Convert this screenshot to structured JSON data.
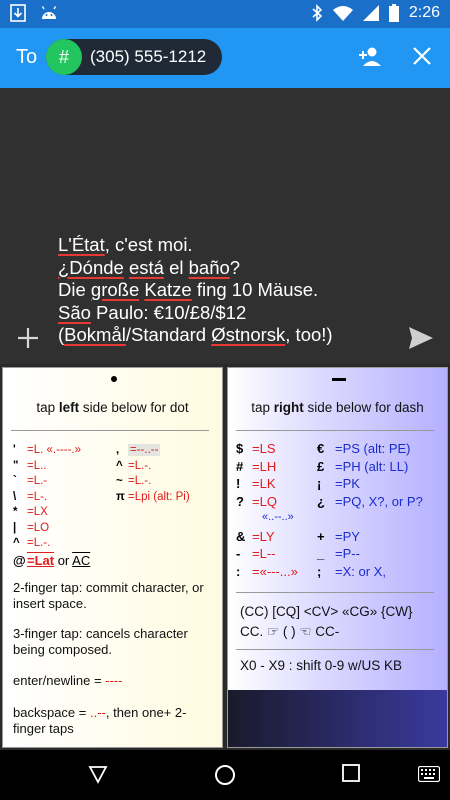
{
  "status": {
    "time": "2:26",
    "icons": [
      "download-icon",
      "android-icon",
      "bluetooth-icon",
      "wifi-icon",
      "signal-icon",
      "battery-icon"
    ]
  },
  "appbar": {
    "to_label": "To",
    "recipient_avatar": "#",
    "recipient": "(305) 555-1212",
    "icons": [
      "add-contact-icon",
      "close-icon"
    ]
  },
  "message": {
    "lines": [
      "L'État, c'est moi.",
      "¿Dónde está el baño?",
      "Die große Katze fing 10 Mäuse.",
      "São Paulo: €10/£8/$12",
      "(Bokmål/Standard Østnorsk, too!)"
    ]
  },
  "keyboard": {
    "left": {
      "symbol": "dot",
      "hint_pre": "tap ",
      "hint_bold": "left",
      "hint_post": " side below for dot",
      "col1": [
        {
          "k": "'",
          "v": "=L. «.----.»"
        },
        {
          "k": "\"",
          "v": "=L.."
        },
        {
          "k": "`",
          "v": "=L.-"
        },
        {
          "k": "\\",
          "v": "=L-."
        },
        {
          "k": "*",
          "v": "=LX"
        },
        {
          "k": "|",
          "v": "=LO"
        },
        {
          "k": "^",
          "v": "=L.-."
        }
      ],
      "col2": [
        {
          "k": ",",
          "v": "=--..--"
        },
        {
          "k": "^",
          "v": "=L.-."
        },
        {
          "k": "~",
          "v": "=L.-."
        },
        {
          "k": "π",
          "v": "=Lpi (alt: Pi)"
        }
      ],
      "at_line": {
        "k": "@",
        "v1": "=Lat",
        "or": " or ",
        "v2": "AC"
      },
      "p1": "2-finger tap: commit character, or insert space.",
      "p2": "3-finger tap: cancels character being composed.",
      "p3_pre": "enter/newline = ",
      "p3_code": "----",
      "p4_pre": "backspace = ",
      "p4_code": "..--",
      "p4_post": ", then one+ 2-finger taps"
    },
    "right": {
      "symbol": "dash",
      "hint_pre": "tap ",
      "hint_bold": "right",
      "hint_post": " side below for dash",
      "rows": [
        {
          "k": "$",
          "v": "=LS",
          "k2": "€",
          "v2": "=PS (alt: PE)"
        },
        {
          "k": "#",
          "v": "=LH",
          "k2": "£",
          "v2": "=PH (alt: LL)"
        },
        {
          "k": "!",
          "v": "=LK",
          "k2": "¡",
          "v2": "=PK"
        },
        {
          "k": "?",
          "v": "=LQ",
          "k2": "¿",
          "v2": "=PQ, X?, or P?"
        },
        {
          "k": "",
          "v": "",
          "k2": "",
          "v2": "«..--..»"
        },
        {
          "k": "&",
          "v": "=LY",
          "k2": "+",
          "v2": "=PY"
        },
        {
          "k": "-",
          "v": "=L--",
          "k2": "_",
          "v2": "=P--"
        },
        {
          "k": ":",
          "v": "=«---...»",
          "k2": ";",
          "v2": "=X: or X,"
        }
      ],
      "prosigns": "(CC) [CQ] <CV> «CG» {CW}",
      "cc_line": "CC. ☞ ( ) ☜ CC-",
      "shift": "X0 - X9 : shift 0-9 w/US KB"
    }
  },
  "navbar": {
    "icons": [
      "back-icon",
      "home-icon",
      "recents-icon",
      "keyboard-switch-icon"
    ]
  }
}
